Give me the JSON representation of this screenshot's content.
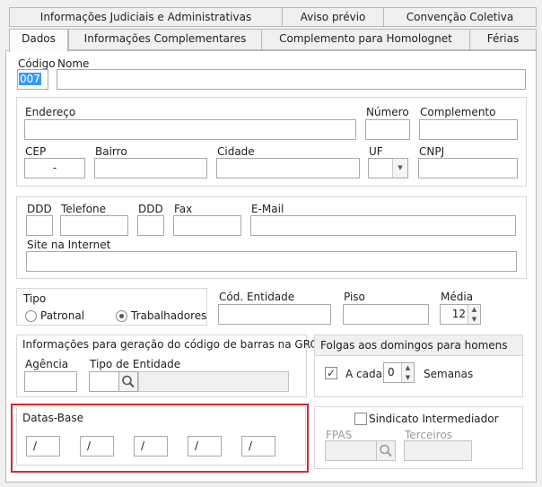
{
  "tabs_row1": [
    "Informações Judiciais e Administrativas",
    "Aviso prévio",
    "Convenção Coletiva"
  ],
  "tabs_row2": [
    "Dados",
    "Informações Complementares",
    "Complemento para Homolognet",
    "Férias"
  ],
  "fields": {
    "codigo_label": "Código",
    "codigo_value": "007",
    "nome_label": "Nome",
    "endereco_label": "Endereço",
    "numero_label": "Número",
    "complemento_label": "Complemento",
    "cep_label": "CEP",
    "cep_value": "-",
    "bairro_label": "Bairro",
    "cidade_label": "Cidade",
    "uf_label": "UF",
    "cnpj_label": "CNPJ",
    "ddd1_label": "DDD",
    "telefone_label": "Telefone",
    "ddd2_label": "DDD",
    "fax_label": "Fax",
    "email_label": "E-Mail",
    "site_label": "Site na Internet"
  },
  "tipo": {
    "label": "Tipo",
    "options": [
      "Patronal",
      "Trabalhadores"
    ],
    "selected": "Trabalhadores"
  },
  "cod_entidade_label": "Cód. Entidade",
  "piso_label": "Piso",
  "media": {
    "label": "Média",
    "value": "12"
  },
  "grcsu": {
    "title": "Informações para geração do código de barras na GRCSU",
    "agencia_label": "Agência",
    "tipo_entidade_label": "Tipo de Entidade"
  },
  "folgas": {
    "title": "Folgas aos domingos para homens",
    "checkbox_label": "A cada",
    "checked": true,
    "value": "0",
    "unit": "Semanas"
  },
  "datas_base": {
    "title": "Datas-Base",
    "values": [
      "/",
      "/",
      "/",
      "/",
      "/"
    ],
    "highlight_color": "#d9262c"
  },
  "sindicato": {
    "checkbox_label": "Sindicato Intermediador",
    "checked": false,
    "fpas_label": "FPAS",
    "terceiros_label": "Terceiros"
  }
}
